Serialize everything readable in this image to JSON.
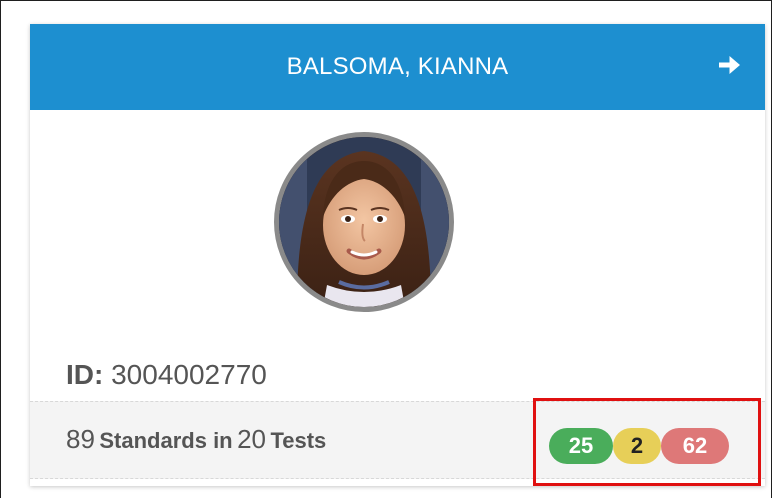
{
  "student": {
    "name": "BALSOMA, KIANNA",
    "id_label": "ID:",
    "id_value": "3004002770",
    "avatar_alt": "student photo"
  },
  "summary": {
    "standards_count": "89",
    "standards_label": "Standards in",
    "tests_count": "20",
    "tests_label": "Tests"
  },
  "badges": [
    {
      "value": "25",
      "color": "#4aad5b"
    },
    {
      "value": "2",
      "color": "#e7cf58"
    },
    {
      "value": "62",
      "color": "#de7878"
    }
  ],
  "icons": {
    "header_action": "arrow-right-icon"
  },
  "colors": {
    "header": "#1d8fd0",
    "highlight_outline": "#e01010"
  }
}
